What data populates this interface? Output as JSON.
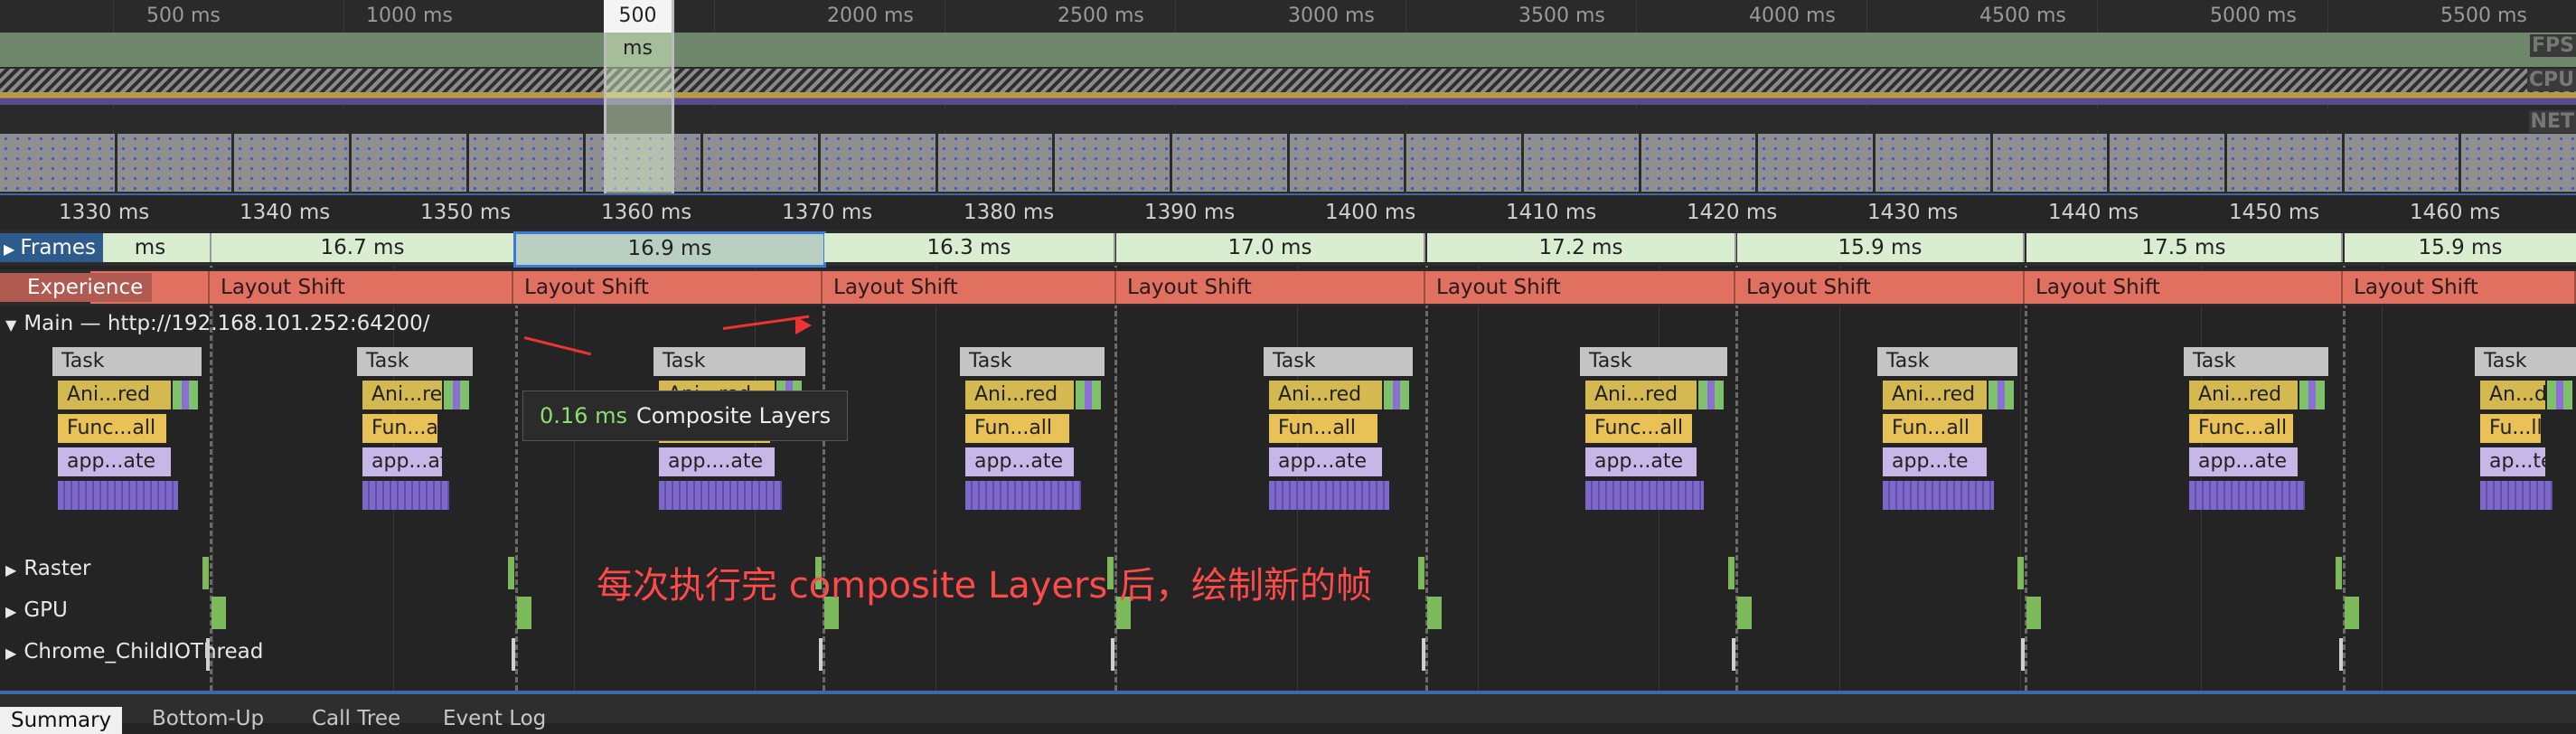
{
  "overview": {
    "ticks": [
      "500 ms",
      "1000 ms",
      "500 ms",
      "2000 ms",
      "2500 ms",
      "3000 ms",
      "3500 ms",
      "4000 ms",
      "4500 ms",
      "5000 ms",
      "5500 ms"
    ],
    "side_labels": [
      "FPS",
      "CPU",
      "NET"
    ]
  },
  "ruler": {
    "ticks": [
      "1330 ms",
      "1340 ms",
      "1350 ms",
      "1360 ms",
      "1370 ms",
      "1380 ms",
      "1390 ms",
      "1400 ms",
      "1410 ms",
      "1420 ms",
      "1430 ms",
      "1440 ms",
      "1450 ms",
      "1460 ms"
    ]
  },
  "tracks": {
    "frames_label": "Frames",
    "frames": [
      "ms",
      "16.7 ms",
      "16.9 ms",
      "16.3 ms",
      "17.0 ms",
      "17.2 ms",
      "15.9 ms",
      "17.5 ms",
      "15.9 ms"
    ],
    "experience_label": "Experience",
    "layout_shift": "Layout Shift",
    "main_title": "Main — http://192.168.101.252:64200/",
    "raster": "Raster",
    "gpu": "GPU",
    "io": "Chrome_ChildIOThread"
  },
  "flame": {
    "task": "Task",
    "groups": [
      [
        "Ani...red",
        "Func...all",
        "app...ate"
      ],
      [
        "Ani...red",
        "Fun...all",
        "app...ate"
      ],
      [
        "Ani...red",
        "Fun...all",
        "app....ate"
      ],
      [
        "Ani...red",
        "Fun...all",
        "app...ate"
      ],
      [
        "Ani...red",
        "Fun...all",
        "app...ate"
      ],
      [
        "Ani...red",
        "Func...all",
        "app...ate"
      ],
      [
        "Ani...red",
        "Fun...all",
        "app...te"
      ],
      [
        "Ani...red",
        "Func...all",
        "app...ate"
      ],
      [
        "An...d",
        "Fu...ll",
        "ap...te"
      ]
    ]
  },
  "tooltip": {
    "time": "0.16 ms",
    "name": "Composite Layers"
  },
  "annotation": "每次执行完 composite Layers 后，绘制新的帧",
  "tabs": [
    "Summary",
    "Bottom-Up",
    "Call Tree",
    "Event Log"
  ],
  "colors": {
    "selection": "#3c7ad6",
    "annotation": "#ff4a4a",
    "frame_bg": "#d9eed0",
    "layout_shift": "#e07060"
  }
}
